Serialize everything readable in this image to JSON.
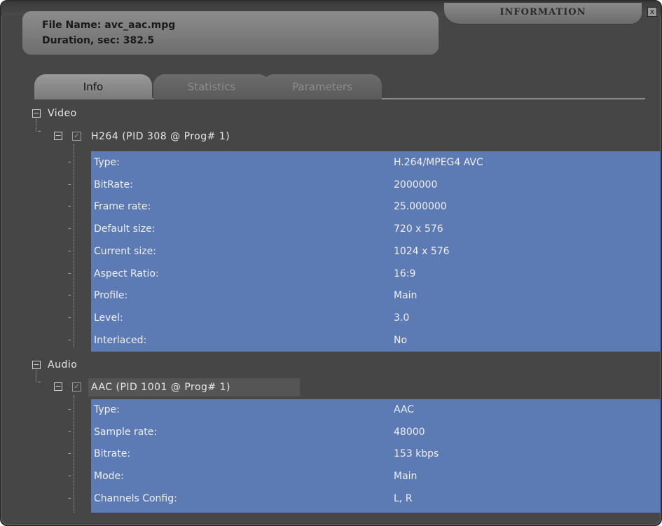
{
  "window": {
    "title": "INFORMATION",
    "close_label": "x"
  },
  "file": {
    "name_line": "File Name: avc_aac.mpg",
    "duration_line": "Duration, sec: 382.5"
  },
  "tabs": [
    {
      "label": "Info",
      "active": true
    },
    {
      "label": "Statistics",
      "active": false
    },
    {
      "label": "Parameters",
      "active": false
    }
  ],
  "tree": {
    "video": {
      "label": "Video",
      "stream_label": "H264 (PID 308 @ Prog# 1)",
      "props": [
        {
          "key": "Type:",
          "value": "H.264/MPEG4 AVC"
        },
        {
          "key": "BitRate:",
          "value": "2000000"
        },
        {
          "key": "Frame rate:",
          "value": "25.000000"
        },
        {
          "key": "Default size:",
          "value": "720 x 576"
        },
        {
          "key": "Current size:",
          "value": "1024 x 576"
        },
        {
          "key": "Aspect Ratio:",
          "value": "16:9"
        },
        {
          "key": "Profile:",
          "value": "Main"
        },
        {
          "key": "Level:",
          "value": "3.0"
        },
        {
          "key": "Interlaced:",
          "value": "No"
        }
      ]
    },
    "audio": {
      "label": "Audio",
      "stream_label": "AAC (PID 1001 @ Prog# 1)",
      "props": [
        {
          "key": "Type:",
          "value": "AAC"
        },
        {
          "key": "Sample rate:",
          "value": "48000"
        },
        {
          "key": "Bitrate:",
          "value": "153 kbps"
        },
        {
          "key": "Mode:",
          "value": "Main"
        },
        {
          "key": "Channels Config:",
          "value": "L, R"
        }
      ]
    }
  },
  "colors": {
    "panel": "#5c7ab4",
    "window": "#464646"
  }
}
